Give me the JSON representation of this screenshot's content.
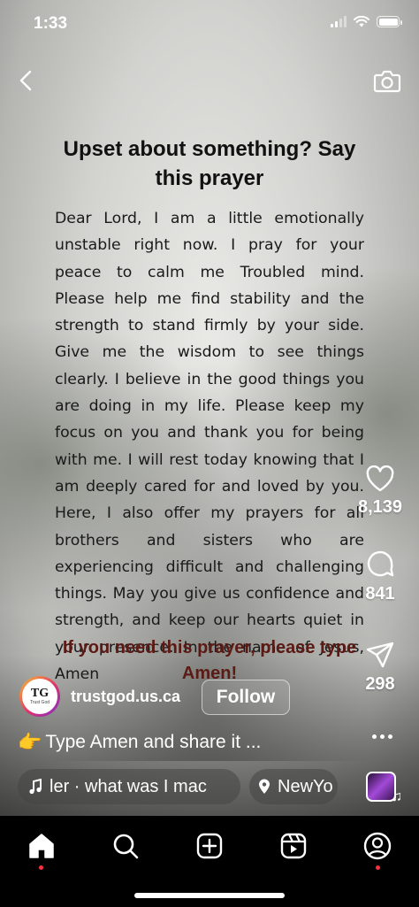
{
  "status_bar": {
    "time": "1:33"
  },
  "post": {
    "title": "Upset about something? Say this prayer",
    "body": "Dear Lord, I am a little emotionally unstable right now. I pray for your peace to calm me Troubled mind. Please help me find stability and the strength to stand firmly by your side. Give me the wisdom to see things clearly. I believe in the good things you are doing in my life. Please keep my focus on you and thank you for being with me. I will rest today knowing that I am deeply cared for and loved by you. Here, I also offer my prayers for all brothers and sisters who are experiencing difficult and challenging things. May you give us confidence and strength, and keep our hearts quiet in your presence. In the name of Jesus, Amen",
    "cta": "If you need this prayer, please type Amen!"
  },
  "actions": {
    "likes": "8,139",
    "comments": "841",
    "shares": "298"
  },
  "author": {
    "avatar_text": "TG",
    "avatar_subtext": "Trust God",
    "username": "trustgod.us.ca",
    "follow_label": "Follow"
  },
  "caption": {
    "emoji": "👉",
    "text": "Type Amen and share it ..."
  },
  "audio": {
    "text": "ler · what was I mac"
  },
  "location": {
    "text": "NewYo"
  },
  "colors": {
    "accent_red": "#ff3040",
    "cta_text": "#5c1a14"
  },
  "icons": {
    "top": [
      "back-icon",
      "camera-icon"
    ],
    "rail": [
      "heart-icon",
      "comment-icon",
      "share-icon",
      "more-icon"
    ],
    "nav": [
      "home-icon",
      "search-icon",
      "create-icon",
      "reels-icon",
      "profile-icon"
    ]
  }
}
